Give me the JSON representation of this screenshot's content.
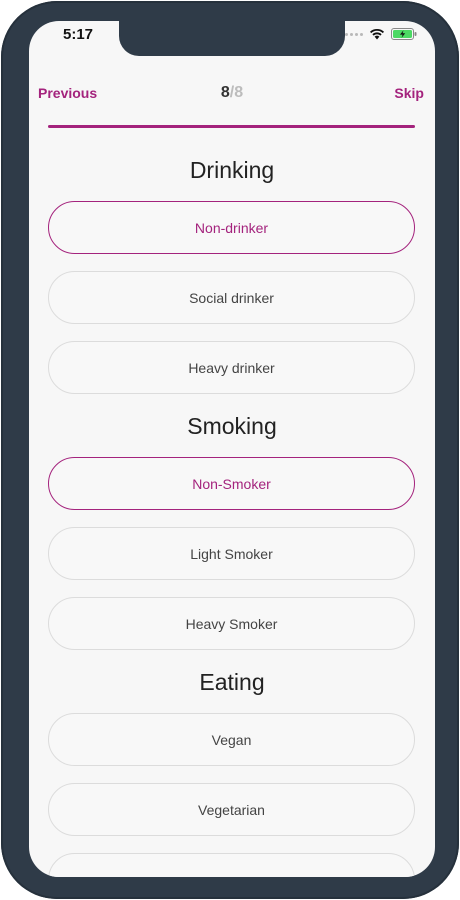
{
  "status_bar": {
    "time": "5:17",
    "icons": [
      "signal-icon",
      "wifi-icon",
      "battery-charging-icon"
    ]
  },
  "nav": {
    "previous_label": "Previous",
    "skip_label": "Skip",
    "step_current": "8",
    "step_separator": "/",
    "step_total": "8",
    "progress": 1.0
  },
  "colors": {
    "accent": "#a4237d",
    "frame": "#2f3b48",
    "background": "#f7f7f7"
  },
  "sections": {
    "drinking": {
      "title": "Drinking",
      "options": [
        {
          "label": "Non-drinker",
          "selected": true
        },
        {
          "label": "Social drinker",
          "selected": false
        },
        {
          "label": "Heavy drinker",
          "selected": false
        }
      ]
    },
    "smoking": {
      "title": "Smoking",
      "options": [
        {
          "label": "Non-Smoker",
          "selected": true
        },
        {
          "label": "Light Smoker",
          "selected": false
        },
        {
          "label": "Heavy Smoker",
          "selected": false
        }
      ]
    },
    "eating": {
      "title": "Eating",
      "options": [
        {
          "label": "Vegan",
          "selected": false
        },
        {
          "label": "Vegetarian",
          "selected": false
        },
        {
          "label": "",
          "selected": false
        }
      ]
    }
  }
}
